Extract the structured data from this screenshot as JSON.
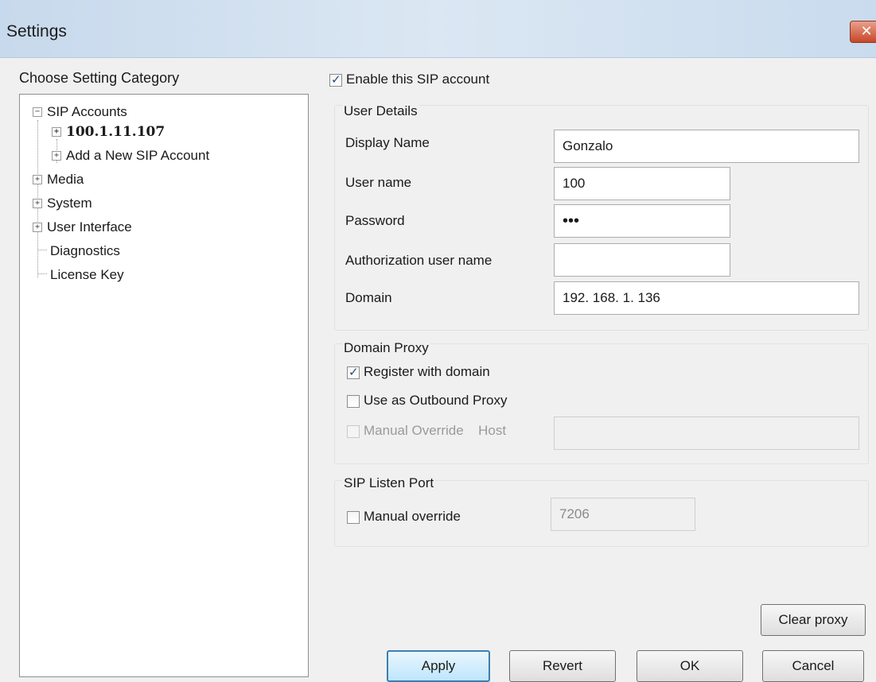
{
  "window": {
    "title": "Settings",
    "close_label": "✕"
  },
  "sidebar": {
    "label": "Choose Setting Category",
    "tree": [
      {
        "label": "SIP Accounts",
        "expander": "−"
      },
      {
        "label": "100.1.11.107",
        "expander": "+"
      },
      {
        "label": "Add a New SIP Account",
        "expander": "+"
      },
      {
        "label": "Media",
        "expander": "+"
      },
      {
        "label": "System",
        "expander": "+"
      },
      {
        "label": "User Interface",
        "expander": "+"
      },
      {
        "label": "Diagnostics"
      },
      {
        "label": "License Key"
      }
    ]
  },
  "account": {
    "enable_label": "Enable this SIP account",
    "enable_checked": true
  },
  "user_details": {
    "title": "User Details",
    "display_name_label": "Display Name",
    "display_name_value": "Gonzalo",
    "user_name_label": "User name",
    "user_name_value": "100",
    "password_label": "Password",
    "password_value": "•••",
    "auth_user_label": "Authorization user name",
    "auth_user_value": "",
    "domain_label": "Domain",
    "domain_value": "192. 168. 1. 136"
  },
  "domain_proxy": {
    "title": "Domain Proxy",
    "register_label": "Register with domain",
    "outbound_label": "Use as Outbound Proxy",
    "manual_label": "Manual Override",
    "host_label": "Host",
    "host_value": ""
  },
  "listen_port": {
    "title": "SIP Listen Port",
    "manual_label": "Manual override",
    "port_value": "7206"
  },
  "buttons": {
    "clear_proxy": "Clear proxy",
    "apply": "Apply",
    "revert": "Revert",
    "ok": "OK",
    "cancel": "Cancel"
  }
}
